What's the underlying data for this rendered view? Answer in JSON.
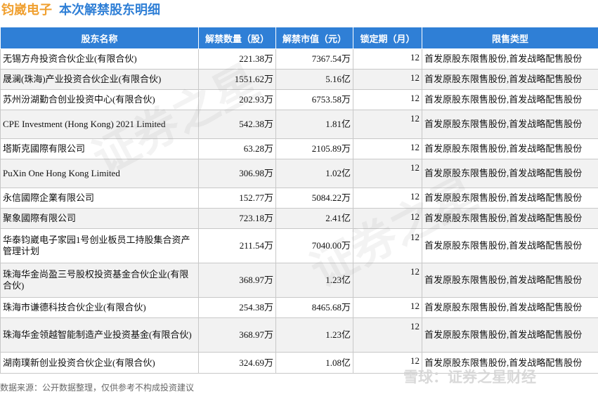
{
  "header": {
    "company": "钧崴电子",
    "subtitle": "本次解禁股东明细"
  },
  "columns": [
    "股东名称",
    "解禁数量（股）",
    "解禁市值（元）",
    "锁定期（月）",
    "限售类型"
  ],
  "rows": [
    {
      "name": "无锡方舟投资合伙企业(有限合伙)",
      "qty": "221.38万",
      "value": "7367.54万",
      "lock": "12",
      "type": "首发原股东限售股份,首发战略配售股份"
    },
    {
      "name": "晟澜(珠海)产业投资合伙企业(有限合伙)",
      "qty": "1551.62万",
      "value": "5.16亿",
      "lock": "12",
      "type": "首发原股东限售股份,首发战略配售股份"
    },
    {
      "name": "苏州汾湖勤合创业投资中心(有限合伙)",
      "qty": "202.93万",
      "value": "6753.58万",
      "lock": "12",
      "type": "首发原股东限售股份,首发战略配售股份"
    },
    {
      "name": "CPE Investment (Hong Kong) 2021 Limited",
      "qty": "542.38万",
      "value": "1.81亿",
      "lock": "12",
      "type": "首发原股东限售股份,首发战略配售股份"
    },
    {
      "name": "塔斯克國際有限公司",
      "qty": "63.28万",
      "value": "2105.89万",
      "lock": "12",
      "type": "首发原股东限售股份,首发战略配售股份"
    },
    {
      "name": "PuXin One Hong Kong Limited",
      "qty": "306.98万",
      "value": "1.02亿",
      "lock": "12",
      "type": "首发原股东限售股份,首发战略配售股份"
    },
    {
      "name": "永信國際企業有限公司",
      "qty": "152.77万",
      "value": "5084.22万",
      "lock": "12",
      "type": "首发原股东限售股份,首发战略配售股份"
    },
    {
      "name": "聚象國際有限公司",
      "qty": "723.18万",
      "value": "2.41亿",
      "lock": "12",
      "type": "首发原股东限售股份,首发战略配售股份"
    },
    {
      "name": "华泰钧崴电子家园1号创业板员工持股集合资产管理计划",
      "qty": "211.54万",
      "value": "7040.00万",
      "lock": "12",
      "type": "首发原股东限售股份,首发战略配售股份"
    },
    {
      "name": "珠海华金尚盈三号股权投资基金合伙企业(有限合伙)",
      "qty": "368.97万",
      "value": "1.23亿",
      "lock": "12",
      "type": "首发原股东限售股份,首发战略配售股份"
    },
    {
      "name": "珠海市谦德科技合伙企业(有限合伙)",
      "qty": "254.38万",
      "value": "8465.68万",
      "lock": "12",
      "type": "首发原股东限售股份,首发战略配售股份"
    },
    {
      "name": "珠海华金领越智能制造产业投资基金(有限合伙)",
      "qty": "368.97万",
      "value": "1.23亿",
      "lock": "12",
      "type": "首发原股东限售股份,首发战略配售股份"
    },
    {
      "name": "湖南璞新创业投资合伙企业(有限合伙)",
      "qty": "324.69万",
      "value": "1.08亿",
      "lock": "12",
      "type": "首发原股东限售股份,首发战略配售股份"
    }
  ],
  "footer": {
    "source": "数据来源：公开数据整理，仅供参考不构成投资建议",
    "brand": "雪球：证券之星财经"
  }
}
